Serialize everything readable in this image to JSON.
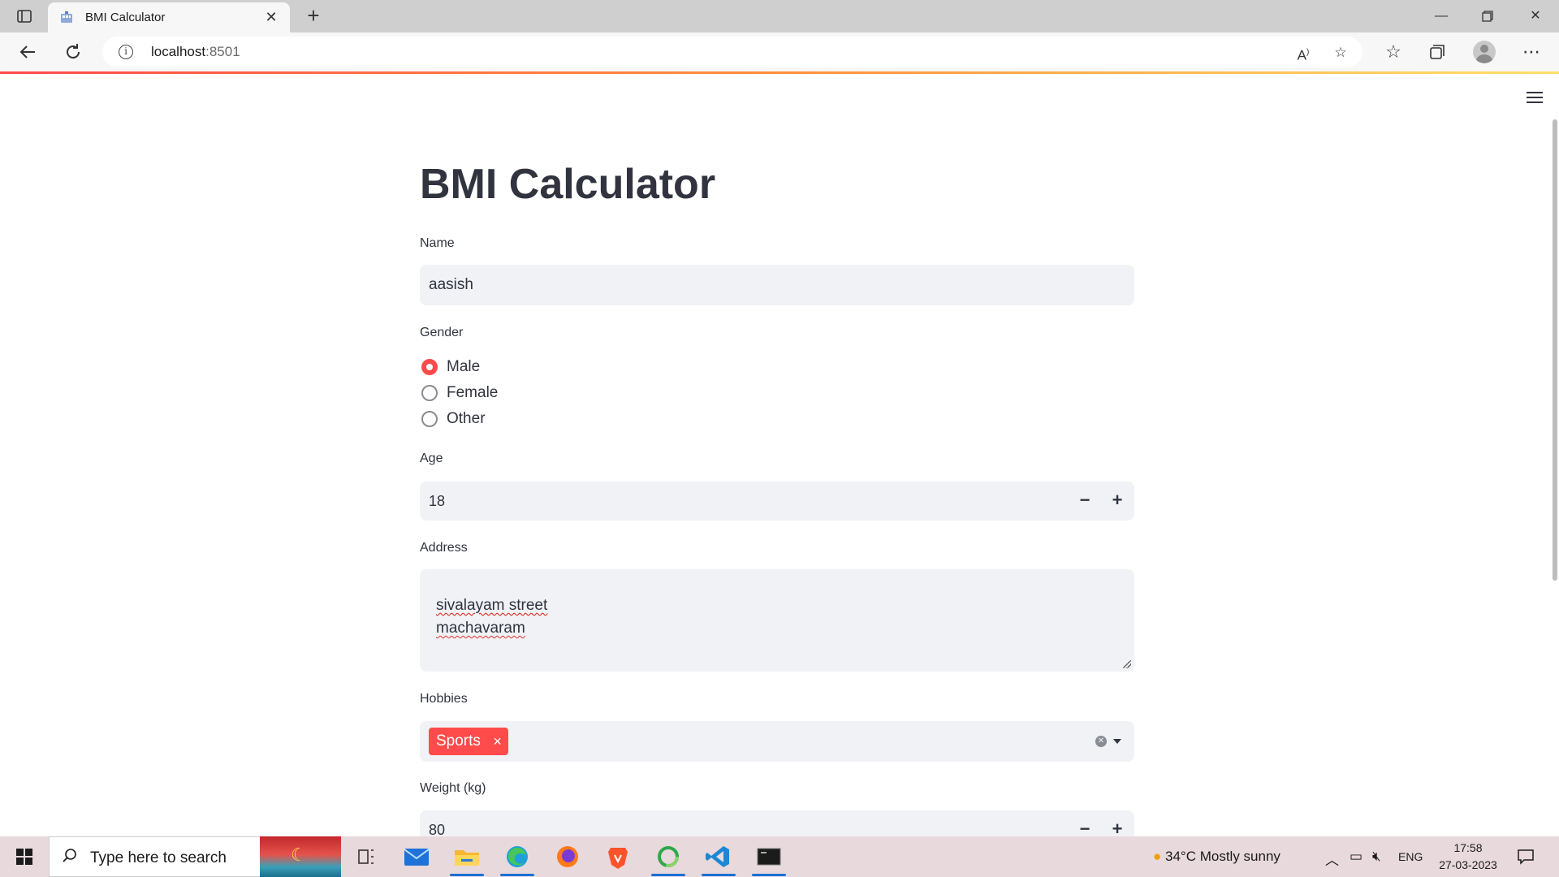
{
  "browser": {
    "tab_title": "BMI Calculator",
    "url_host": "localhost",
    "url_port": ":8501"
  },
  "app": {
    "title": "BMI Calculator",
    "name": {
      "label": "Name",
      "value": "aasish"
    },
    "gender": {
      "label": "Gender",
      "options": [
        "Male",
        "Female",
        "Other"
      ],
      "selected": "Male"
    },
    "age": {
      "label": "Age",
      "value": "18",
      "decrement": "−",
      "increment": "+"
    },
    "address": {
      "label": "Address",
      "lines": [
        "sivalayam street",
        "machavaram"
      ]
    },
    "hobbies": {
      "label": "Hobbies",
      "selected": [
        "Sports"
      ],
      "remove_glyph": "×"
    },
    "weight": {
      "label": "Weight (kg)",
      "value": "80",
      "decrement": "−",
      "increment": "+"
    }
  },
  "taskbar": {
    "search_placeholder": "Type here to search",
    "weather": "34°C  Mostly sunny",
    "language": "ENG",
    "time": "17:58",
    "date": "27-03-2023"
  },
  "colors": {
    "accent": "#ff4b4b",
    "input_bg": "#f0f2f6",
    "text": "#31333f"
  }
}
